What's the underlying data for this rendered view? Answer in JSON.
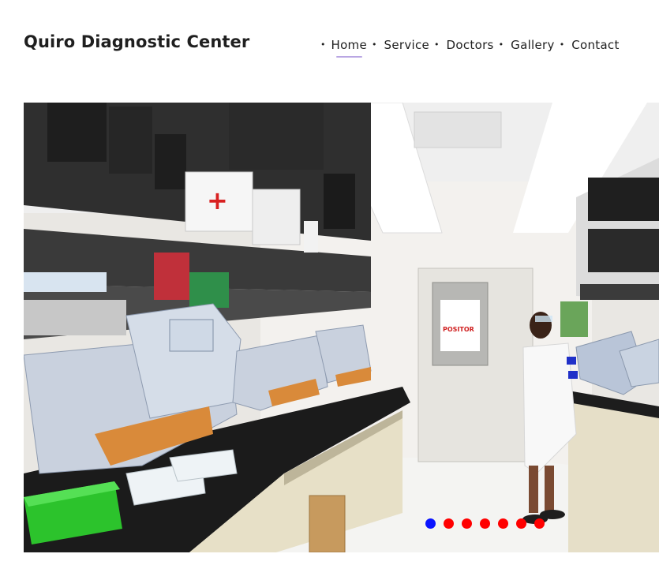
{
  "site": {
    "title": "Quiro Diagnostic Center"
  },
  "nav": {
    "items": [
      {
        "label": "Home",
        "active": true
      },
      {
        "label": "Service",
        "active": false
      },
      {
        "label": "Doctors",
        "active": false
      },
      {
        "label": "Gallery",
        "active": false
      },
      {
        "label": "Contact",
        "active": false
      }
    ],
    "bullet": "•",
    "underline_color": "#b9a6e3"
  },
  "slider": {
    "image_icon": "lab-photo",
    "dots": {
      "count": 7,
      "active_index": 0,
      "active_color": "#0a14ff",
      "inactive_color": "#ff0000"
    },
    "door_sign": "POSITOR"
  }
}
